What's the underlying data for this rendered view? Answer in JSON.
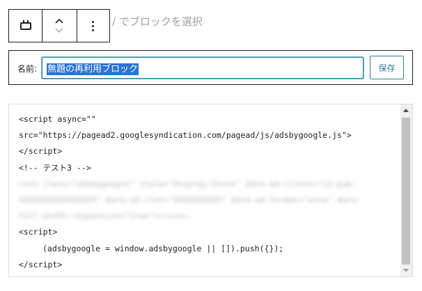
{
  "toolbar": {
    "block_icon": "reusable-block-icon",
    "move_up_icon": "chevron-up-icon",
    "move_down_icon": "chevron-down-icon",
    "more_icon": "more-vertical-icon",
    "select_hint": "/ でブロックを選択"
  },
  "reusable": {
    "name_label": "名前:",
    "name_value": "無題の再利用ブロック",
    "save_label": "保存"
  },
  "code": {
    "lines": [
      "<script async=\"\"",
      "src=\"https://pagead2.googlesyndication.com/pagead/js/adsbygoogle.js\">",
      "</scr",
      "<!-- テスト3 -->",
      "<ins class=\"adsbygoogle\" style=\"display:block\" data-ad-client=\"ca-pub-",
      "XXXXXXXXXXXXXXXX\" data-ad-slot=\"XXXXXXXXXX\" data-ad-format=\"auto\" data-",
      "full-width-responsive=\"true\"></ins>",
      "<script>",
      "(adsbygoogle = window.adsbygoogle || []).push({});",
      "</scr"
    ],
    "blurred_note": "redacted"
  },
  "colors": {
    "accent": "#2f7e96",
    "selection": "#2a74d6"
  }
}
